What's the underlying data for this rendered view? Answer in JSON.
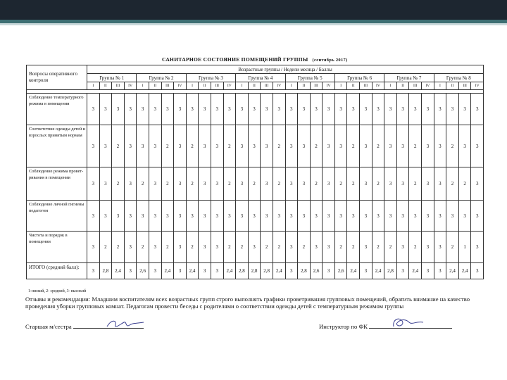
{
  "title": "САНИТАРНОЕ СОСТОЯНИЕ ПОМЕЩЕНИЙ ГРУППЫ",
  "period": "(сентябрь 2017)",
  "question_header": "Вопросы оперативного контроля",
  "groups_header": "Возрастные группы / Недели месяца / Баллы",
  "groups": [
    "Группа № 1",
    "Группа № 2",
    "Группа № 3",
    "Группа № 4",
    "Группа № 5",
    "Группа № 6",
    "Группа № 7",
    "Группа № 8"
  ],
  "weeks": [
    "I",
    "II",
    "III",
    "IV"
  ],
  "rows": [
    {
      "label": "Соблюдение температурного режима в помещении",
      "values": [
        "3",
        "3",
        "3",
        "3",
        "3",
        "3",
        "3",
        "3",
        "3",
        "3",
        "3",
        "3",
        "3",
        "3",
        "3",
        "3",
        "3",
        "3",
        "3",
        "3",
        "3",
        "3",
        "3",
        "3",
        "3",
        "3",
        "3",
        "3",
        "3",
        "3",
        "3",
        "3"
      ]
    },
    {
      "label": "Соответствие одежды детей и взрослых принятым нормам",
      "values": [
        "3",
        "3",
        "2",
        "3",
        "3",
        "3",
        "2",
        "3",
        "2",
        "3",
        "3",
        "2",
        "3",
        "3",
        "3",
        "2",
        "3",
        "3",
        "2",
        "3",
        "3",
        "2",
        "3",
        "2",
        "3",
        "3",
        "2",
        "3",
        "3",
        "2",
        "3",
        "3"
      ]
    },
    {
      "label": "Соблюдение режима провет-ривания в помещении",
      "values": [
        "3",
        "3",
        "2",
        "3",
        "2",
        "3",
        "2",
        "3",
        "2",
        "3",
        "3",
        "2",
        "3",
        "2",
        "3",
        "2",
        "3",
        "3",
        "2",
        "3",
        "2",
        "2",
        "3",
        "2",
        "3",
        "3",
        "2",
        "3",
        "3",
        "2",
        "2",
        "3"
      ]
    },
    {
      "label": "Соблюдение личной гигиены педагогом",
      "values": [
        "3",
        "3",
        "3",
        "3",
        "3",
        "3",
        "3",
        "3",
        "3",
        "3",
        "3",
        "3",
        "3",
        "3",
        "3",
        "3",
        "3",
        "3",
        "3",
        "3",
        "3",
        "3",
        "3",
        "3",
        "3",
        "3",
        "3",
        "3",
        "3",
        "3",
        "3",
        "3"
      ]
    },
    {
      "label": "Чистота и порядок в помещении",
      "values": [
        "3",
        "2",
        "2",
        "3",
        "2",
        "3",
        "2",
        "3",
        "2",
        "3",
        "3",
        "2",
        "2",
        "3",
        "2",
        "2",
        "3",
        "2",
        "3",
        "3",
        "2",
        "2",
        "3",
        "2",
        "2",
        "3",
        "2",
        "3",
        "3",
        "2",
        "1",
        "3"
      ]
    }
  ],
  "total_label": "ИТОГО (средний балл):",
  "totals": [
    "3",
    "2,8",
    "2,4",
    "3",
    "2,6",
    "3",
    "2,4",
    "3",
    "2,4",
    "3",
    "3",
    "2,4",
    "2,8",
    "2,8",
    "2,8",
    "2,4",
    "3",
    "2,8",
    "2,6",
    "3",
    "2,6",
    "2,4",
    "3",
    "2,4",
    "2,8",
    "3",
    "2,4",
    "3",
    "3",
    "2,4",
    "2,4",
    "3"
  ],
  "legend": "1-низкий,     2- средний,     3- высокий",
  "notes": "Отзывы и рекомендации:  Младшим воспитателям всех возрастных групп строго выполнять графики проветривания групповых помещений, обратить внимание на качество  проведения  уборки групповых комнат.  Педагогам  провести беседы с родителями о соответствии одежды детей с температурным режимом группы",
  "sign_left_label": "Старшая м/сестра",
  "sign_right_label": "Инструктор по ФК"
}
